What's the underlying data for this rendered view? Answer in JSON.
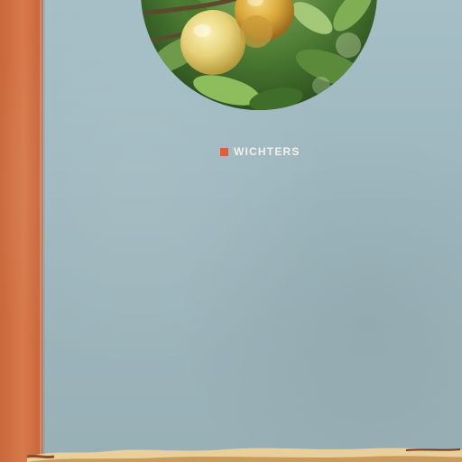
{
  "heading": {
    "label": "WICHTERS"
  },
  "colors": {
    "background": "#a6bfc7",
    "spine": "#d77a4a",
    "accent_square": "#d9623a",
    "heading_text": "#f4f1e6"
  },
  "images": {
    "photo": "fruit-on-branch-photo",
    "bottom": "pastry-crust-photo"
  }
}
